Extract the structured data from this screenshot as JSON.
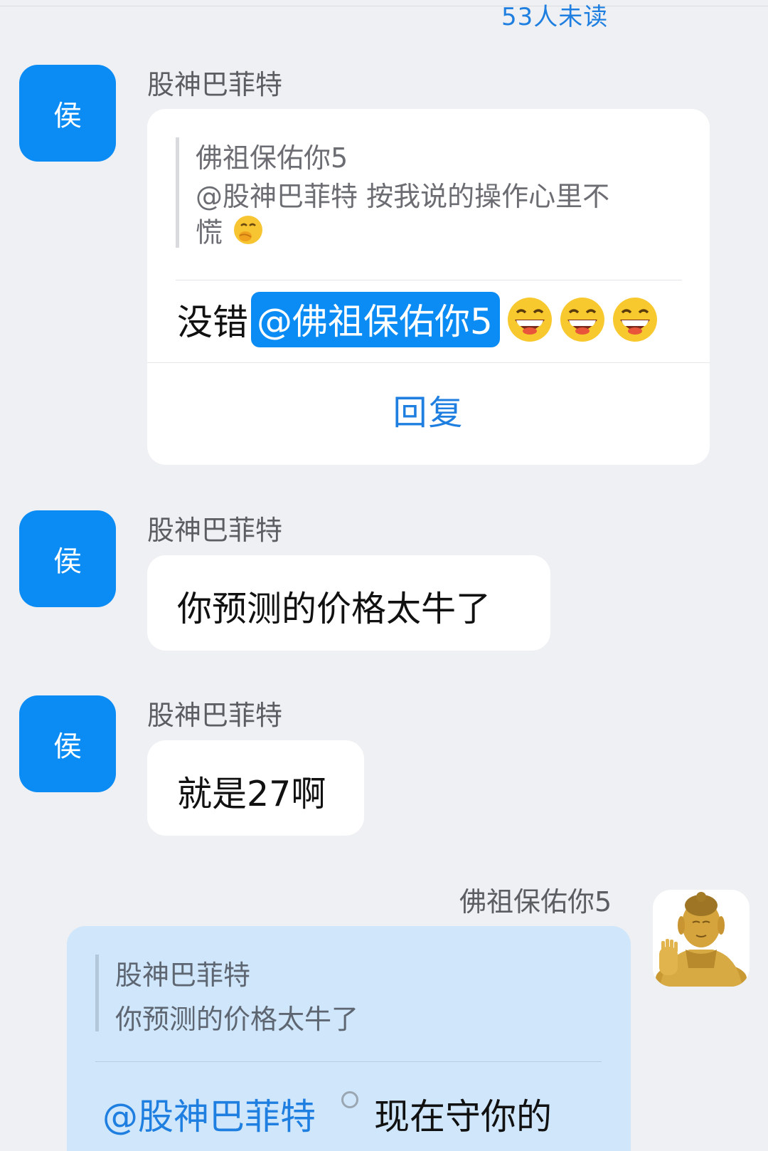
{
  "unread_label": "53人未读",
  "messages": [
    {
      "avatar_text": "侯",
      "sender": "股神巴菲特",
      "quote": {
        "author": "佛祖保佑你5",
        "text": "@股神巴菲特 按我说的操作心里不慌"
      },
      "reply_prefix": "没错",
      "mention": "@佛祖保佑你5",
      "reply_button": "回复"
    },
    {
      "avatar_text": "侯",
      "sender": "股神巴菲特",
      "text": "你预测的价格太牛了"
    },
    {
      "avatar_text": "侯",
      "sender": "股神巴菲特",
      "text": "就是27啊"
    }
  ],
  "my_message": {
    "sender": "佛祖保佑你5",
    "quote_author": "股神巴菲特",
    "quote_text": "你预测的价格太牛了",
    "mention": "@股神巴菲特",
    "text": "现在守你的"
  },
  "colors": {
    "accent": "#0b8cf4",
    "link": "#1f7fe0",
    "background": "#eff0f3",
    "my_bubble": "#cfe6fb"
  }
}
